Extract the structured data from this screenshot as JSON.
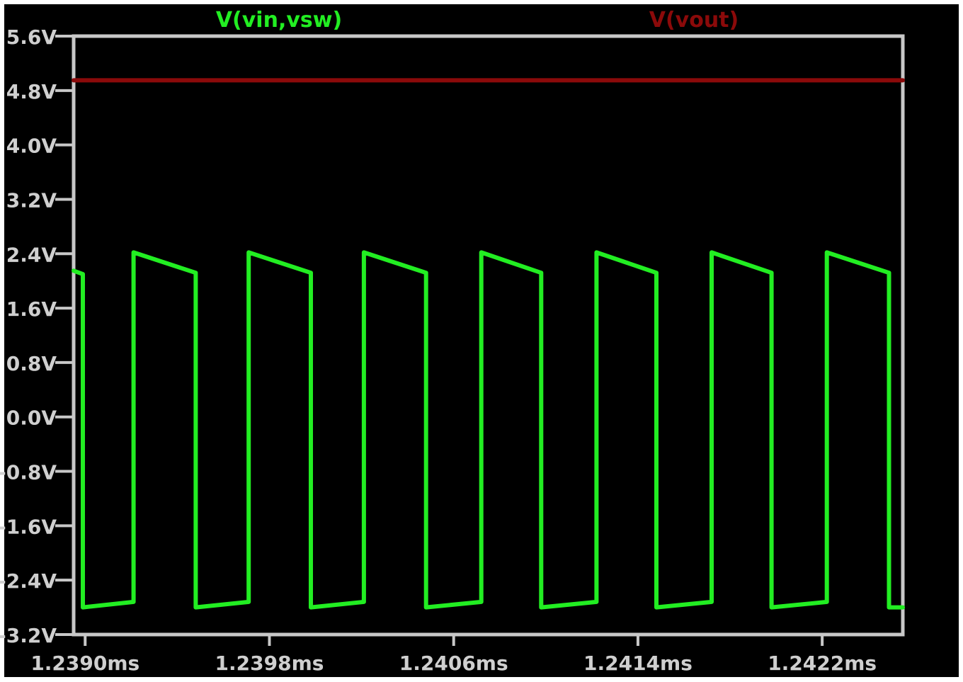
{
  "chart_data": {
    "type": "line",
    "title": "",
    "xlabel": "",
    "ylabel": "",
    "xlim": [
      1.23895,
      1.24255
    ],
    "ylim": [
      -3.2,
      5.6
    ],
    "grid": false,
    "legend_placement": "top",
    "x_ticks": [
      "1.2390ms",
      "1.2398ms",
      "1.2406ms",
      "1.2414ms",
      "1.2422ms"
    ],
    "x_tick_values": [
      1.239,
      1.2398,
      1.2406,
      1.2414,
      1.2422
    ],
    "y_ticks": [
      "5.6V",
      "4.8V",
      "4.0V",
      "3.2V",
      "2.4V",
      "1.6V",
      "0.8V",
      "0.0V",
      "-0.8V",
      "-1.6V",
      "-2.4V",
      "-3.2V"
    ],
    "y_tick_values": [
      5.6,
      4.8,
      4.0,
      3.2,
      2.4,
      1.6,
      0.8,
      0.0,
      -0.8,
      -1.6,
      -2.4,
      -3.2
    ],
    "series": [
      {
        "name": "V(vin,vsw)",
        "color": "#22ee22",
        "x": [
          1.23895,
          1.23899,
          1.23899,
          1.23921,
          1.23921,
          1.23948,
          1.23948,
          1.23971,
          1.23971,
          1.23998,
          1.23998,
          1.24021,
          1.24021,
          1.24048,
          1.24048,
          1.24072,
          1.24072,
          1.24098,
          1.24098,
          1.24122,
          1.24122,
          1.24148,
          1.24148,
          1.24172,
          1.24172,
          1.24198,
          1.24198,
          1.24222,
          1.24222,
          1.24249,
          1.24249,
          1.24255
        ],
        "y": [
          2.15,
          2.1,
          -2.8,
          -2.72,
          2.42,
          2.12,
          -2.8,
          -2.72,
          2.42,
          2.12,
          -2.8,
          -2.72,
          2.42,
          2.12,
          -2.8,
          -2.72,
          2.42,
          2.12,
          -2.8,
          -2.72,
          2.42,
          2.12,
          -2.8,
          -2.72,
          2.42,
          2.12,
          -2.8,
          -2.72,
          2.42,
          2.12,
          -2.8,
          -2.8
        ]
      },
      {
        "name": "V(vout)",
        "color": "#8b0a0a",
        "x": [
          1.23895,
          1.24255
        ],
        "y": [
          4.95,
          4.95
        ]
      }
    ]
  },
  "colors": {
    "background": "#000000",
    "frame": "#c8c8c8",
    "tick_text": "#cfcfcf"
  }
}
